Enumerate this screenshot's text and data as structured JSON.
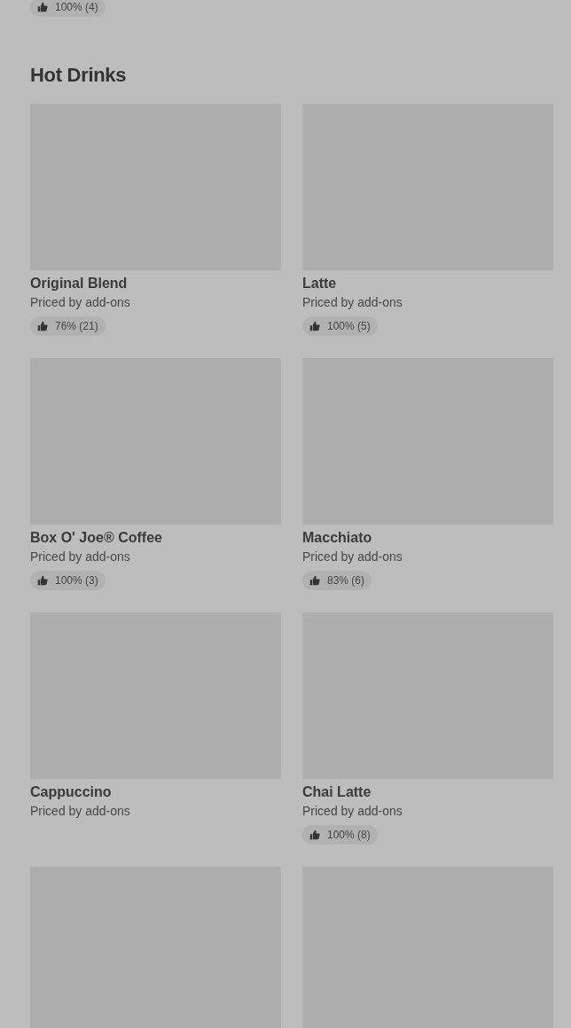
{
  "previous_item": {
    "rating": "100% (4)"
  },
  "section": {
    "title": "Hot Drinks"
  },
  "items": [
    {
      "kind": "product",
      "name": "Original Blend",
      "price": "Priced by add-ons",
      "rating": "76% (21)"
    },
    {
      "kind": "product",
      "name": "Latte",
      "price": "Priced by add-ons",
      "rating": "100% (5)"
    },
    {
      "kind": "product",
      "name": "Box O' Joe® Coffee",
      "price": "Priced by add-ons",
      "rating": "100% (3)"
    },
    {
      "kind": "product",
      "name": "Macchiato",
      "price": "Priced by add-ons",
      "rating": "83% (6)"
    },
    {
      "kind": "product",
      "name": "Cappuccino",
      "price": "Priced by add-ons"
    },
    {
      "kind": "product",
      "name": "Chai Latte",
      "price": "Priced by add-ons",
      "rating": "100% (8)"
    },
    {
      "kind": "picture"
    },
    {
      "kind": "picture"
    }
  ]
}
